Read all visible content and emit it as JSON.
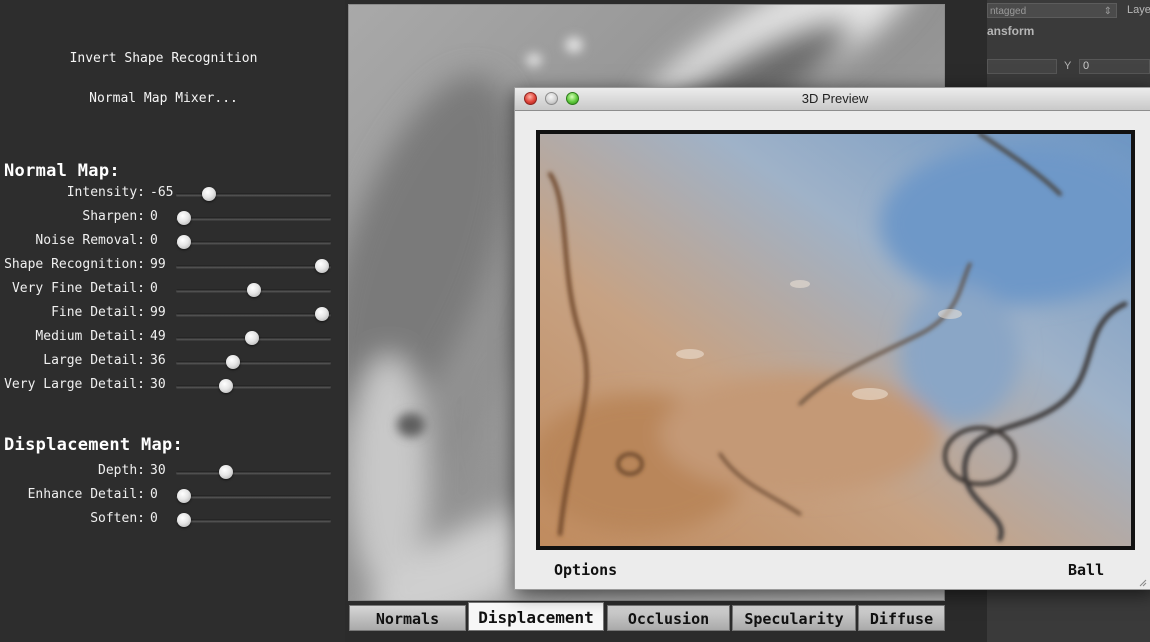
{
  "top_buttons": {
    "invert_label": "Invert Shape Recognition",
    "mixer_label": "Normal Map Mixer..."
  },
  "normal_map": {
    "title": "Normal Map:",
    "sliders": [
      {
        "label": "Intensity:",
        "value": "-65",
        "fraction": 0.21
      },
      {
        "label": "Sharpen:",
        "value": "0",
        "fraction": 0.05
      },
      {
        "label": "Noise Removal:",
        "value": "0",
        "fraction": 0.05
      },
      {
        "label": "Shape Recognition:",
        "value": "99",
        "fraction": 0.94
      },
      {
        "label": "Very Fine Detail:",
        "value": "0",
        "fraction": 0.5
      },
      {
        "label": "Fine Detail:",
        "value": "99",
        "fraction": 0.94
      },
      {
        "label": "Medium Detail:",
        "value": "49",
        "fraction": 0.49
      },
      {
        "label": "Large Detail:",
        "value": "36",
        "fraction": 0.37
      },
      {
        "label": "Very Large Detail:",
        "value": "30",
        "fraction": 0.32
      }
    ]
  },
  "displacement_map": {
    "title": "Displacement Map:",
    "sliders": [
      {
        "label": "Depth:",
        "value": "30",
        "fraction": 0.32
      },
      {
        "label": "Enhance Detail:",
        "value": "0",
        "fraction": 0.05
      },
      {
        "label": "Soften:",
        "value": "0",
        "fraction": 0.05
      }
    ]
  },
  "tabs": [
    "Normals",
    "Displacement",
    "Occlusion",
    "Specularity",
    "Diffuse"
  ],
  "active_tab": "Displacement",
  "preview_window": {
    "title": "3D Preview",
    "options_label": "Options",
    "ball_label": "Ball"
  },
  "inspector": {
    "tag_select": "ntagged",
    "layer_label": "Laye",
    "transform_label": "ansform",
    "y_label": "Y",
    "y_value": "0"
  },
  "colors": {
    "panel_bg": "#2d2d2d",
    "preview_warm": "#c9966a",
    "preview_cool": "#7fa3c7"
  }
}
